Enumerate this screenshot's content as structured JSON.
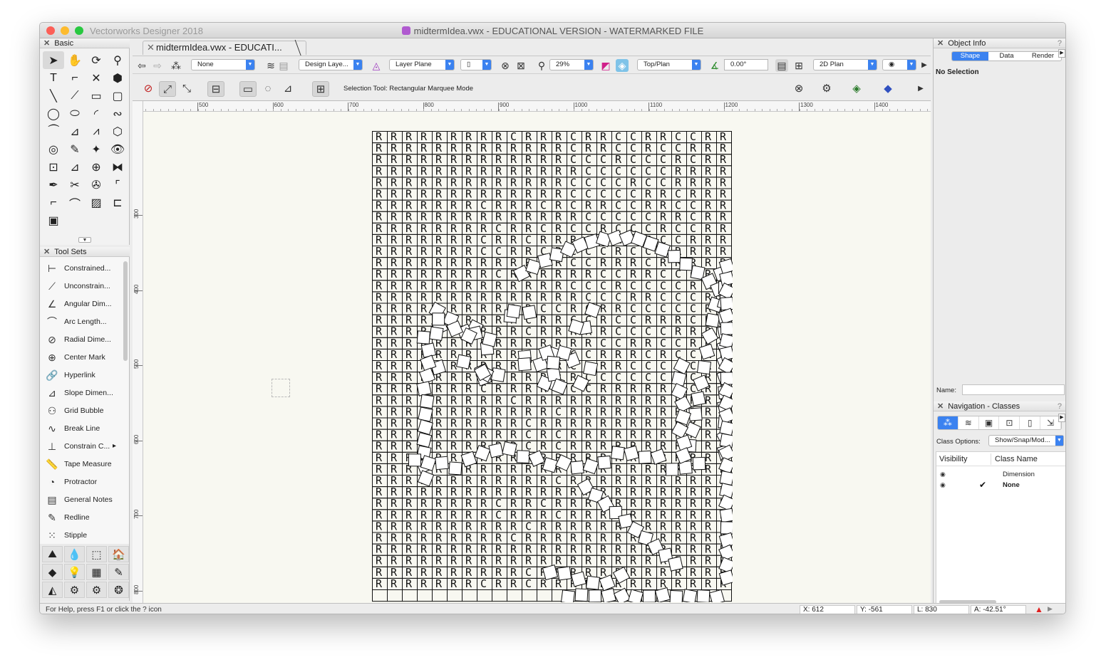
{
  "window": {
    "app_name": "Vectorworks Designer 2018",
    "title": "midtermIdea.vwx - EDUCATIONAL VERSION - WATERMARKED FILE",
    "traffic_colors": [
      "#fc5f57",
      "#fdbb2e",
      "#28c840"
    ]
  },
  "tab": {
    "label": "midtermIdea.vwx - EDUCATI..."
  },
  "basic_palette": {
    "title": "Basic",
    "tools": [
      {
        "name": "selection-tool-icon",
        "glyph": "➤"
      },
      {
        "name": "pan-tool-icon",
        "glyph": "✋"
      },
      {
        "name": "flyover-tool-icon",
        "glyph": "⟳"
      },
      {
        "name": "zoom-tool-icon",
        "glyph": "⚲"
      },
      {
        "name": "text-tool-icon",
        "glyph": "T"
      },
      {
        "name": "callout-tool-icon",
        "glyph": "⌐"
      },
      {
        "name": "x-tool-icon",
        "glyph": "✕"
      },
      {
        "name": "push-pull-tool-icon",
        "glyph": "⬢"
      },
      {
        "name": "line-tool-icon",
        "glyph": "╲"
      },
      {
        "name": "double-line-tool-icon",
        "glyph": "⟋"
      },
      {
        "name": "rectangle-tool-icon",
        "glyph": "▭"
      },
      {
        "name": "rounded-rectangle-tool-icon",
        "glyph": "▢"
      },
      {
        "name": "circle-tool-icon",
        "glyph": "◯"
      },
      {
        "name": "oval-tool-icon",
        "glyph": "⬭"
      },
      {
        "name": "arc-tool-icon",
        "glyph": "◜"
      },
      {
        "name": "freehand-tool-icon",
        "glyph": "∾"
      },
      {
        "name": "polyline-tool-icon",
        "glyph": "⏜"
      },
      {
        "name": "polygon-tool-icon",
        "glyph": "⊿"
      },
      {
        "name": "double-polygon-tool-icon",
        "glyph": "⩘"
      },
      {
        "name": "regular-polygon-tool-icon",
        "glyph": "⬡"
      },
      {
        "name": "spiral-tool-icon",
        "glyph": "◎"
      },
      {
        "name": "eyedropper-tool-icon",
        "glyph": "✎"
      },
      {
        "name": "magic-wand-tool-icon",
        "glyph": "✦"
      },
      {
        "name": "visibility-tool-icon",
        "glyph": "👁"
      },
      {
        "name": "resize-tool-icon",
        "glyph": "⊡"
      },
      {
        "name": "attribute-mapping-tool-icon",
        "glyph": "⊿"
      },
      {
        "name": "rotate-tool-icon",
        "glyph": "⊕"
      },
      {
        "name": "mirror-tool-icon",
        "glyph": "⧓"
      },
      {
        "name": "reshape-tool-icon",
        "glyph": "✒"
      },
      {
        "name": "trim-tool-icon",
        "glyph": "✂"
      },
      {
        "name": "split-tool-icon",
        "glyph": "✇"
      },
      {
        "name": "connect-combine-tool-icon",
        "glyph": "⌜"
      },
      {
        "name": "fillet-tool-icon",
        "glyph": "⌐"
      },
      {
        "name": "chamfer-tool-icon",
        "glyph": "⌒"
      },
      {
        "name": "eraser-tool-icon",
        "glyph": "▨"
      },
      {
        "name": "offset-tool-icon",
        "glyph": "⊏"
      },
      {
        "name": "clip-tool-icon",
        "glyph": "▣"
      }
    ]
  },
  "tool_sets": {
    "title": "Tool Sets",
    "items": [
      {
        "label": "Constrained...",
        "glyph": "⊢"
      },
      {
        "label": "Unconstrain...",
        "glyph": "⟋"
      },
      {
        "label": "Angular Dim...",
        "glyph": "∠"
      },
      {
        "label": "Arc Length...",
        "glyph": "⌒"
      },
      {
        "label": "Radial Dime...",
        "glyph": "⊘"
      },
      {
        "label": "Center Mark",
        "glyph": "⊕"
      },
      {
        "label": "Hyperlink",
        "glyph": "🔗"
      },
      {
        "label": "Slope Dimen...",
        "glyph": "⊿"
      },
      {
        "label": "Grid Bubble",
        "glyph": "⚇"
      },
      {
        "label": "Break Line",
        "glyph": "∿"
      },
      {
        "label": "Constrain C...",
        "glyph": "⊥"
      },
      {
        "label": "Tape Measure",
        "glyph": "📏"
      },
      {
        "label": "Protractor",
        "glyph": "◔"
      },
      {
        "label": "General Notes",
        "glyph": "▤"
      },
      {
        "label": "Redline",
        "glyph": "✎"
      },
      {
        "label": "Stipple",
        "glyph": "⁙"
      }
    ],
    "grid_icons": [
      {
        "name": "site-planning-set-icon",
        "glyph": "⛰"
      },
      {
        "name": "landscape-set-icon",
        "glyph": "💧"
      },
      {
        "name": "building-shell-set-icon",
        "glyph": "⬚"
      },
      {
        "name": "detailing-set-icon",
        "glyph": "🏠"
      },
      {
        "name": "visualization-set-icon",
        "glyph": "◆"
      },
      {
        "name": "lighting-set-icon",
        "glyph": "💡"
      },
      {
        "name": "furniture-set-icon",
        "glyph": "▦"
      },
      {
        "name": "dims-notes-set-icon",
        "glyph": "✎"
      },
      {
        "name": "3d-modeling-set-icon",
        "glyph": "◭"
      },
      {
        "name": "machine-design-set-icon",
        "glyph": "⚙"
      },
      {
        "name": "fasteners-set-icon",
        "glyph": "⚙"
      },
      {
        "name": "settings-set-icon",
        "glyph": "❂"
      }
    ]
  },
  "toolbar": {
    "class_select": "None",
    "layer_select": "Design Laye...",
    "plane_select": "Layer Plane",
    "zoom_select": "29%",
    "view_select": "Top/Plan",
    "angle_value": "0.00°",
    "render_select": "2D Plan",
    "mode_text": "Selection Tool: Rectangular Marquee Mode"
  },
  "rulers": {
    "top": [
      "500",
      "600",
      "700",
      "800",
      "900",
      "1000",
      "1100",
      "1200",
      "1300",
      "1400"
    ],
    "left": [
      "300",
      "400",
      "500",
      "600",
      "700",
      "800"
    ]
  },
  "drawing": {
    "letter_a": "R",
    "letter_b": "C"
  },
  "object_info": {
    "title": "Object Info",
    "tabs": [
      "Shape",
      "Data",
      "Render"
    ],
    "active_tab": "Shape",
    "selection": "No Selection",
    "name_label": "Name:",
    "name_value": ""
  },
  "navigation": {
    "title": "Navigation - Classes",
    "class_options_label": "Class Options:",
    "class_options_value": "Show/Snap/Mod...",
    "columns": [
      "Visibility",
      "Class Name"
    ],
    "rows": [
      {
        "name": "Dimension",
        "active": false
      },
      {
        "name": "None",
        "active": true
      }
    ]
  },
  "status": {
    "help": "For Help, press F1 or click the ? icon",
    "x": "X:  612",
    "y": "Y:  -561",
    "l": "L:  830",
    "a": "A:  -42.51°"
  },
  "accent": "#3b82f0"
}
